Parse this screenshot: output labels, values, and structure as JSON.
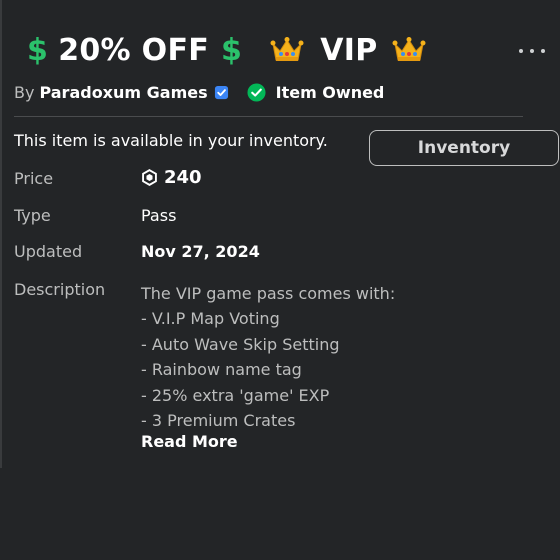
{
  "title": {
    "dollar_left": "$",
    "discount": "20% OFF",
    "dollar_right": "$",
    "name": "VIP",
    "crown_icon": "crown-icon"
  },
  "creator": {
    "prefix": "By",
    "name": "Paradoxum Games",
    "verified_icon": "verified-badge-icon"
  },
  "ownership": {
    "icon": "checkmark-circle-icon",
    "text": "Item Owned"
  },
  "inventory": {
    "message": "This item is available in your inventory.",
    "button_label": "Inventory"
  },
  "details": {
    "price_label": "Price",
    "price_value": "240",
    "price_icon": "robux-icon",
    "type_label": "Type",
    "type_value": "Pass",
    "updated_label": "Updated",
    "updated_value": "Nov 27, 2024",
    "description_label": "Description"
  },
  "description": {
    "lines": [
      "The VIP game pass comes with:",
      "- V.I.P Map Voting",
      "- Auto Wave Skip Setting",
      "- Rainbow name tag",
      "- 25% extra 'game' EXP",
      "- 3 Premium Crates"
    ],
    "read_more": "Read More"
  },
  "colors": {
    "background": "#232527",
    "dollar_green": "#2bc16b",
    "owned_green": "#02b757",
    "verified_blue": "#3b85f5",
    "crown_gold": "#f5b21b"
  }
}
